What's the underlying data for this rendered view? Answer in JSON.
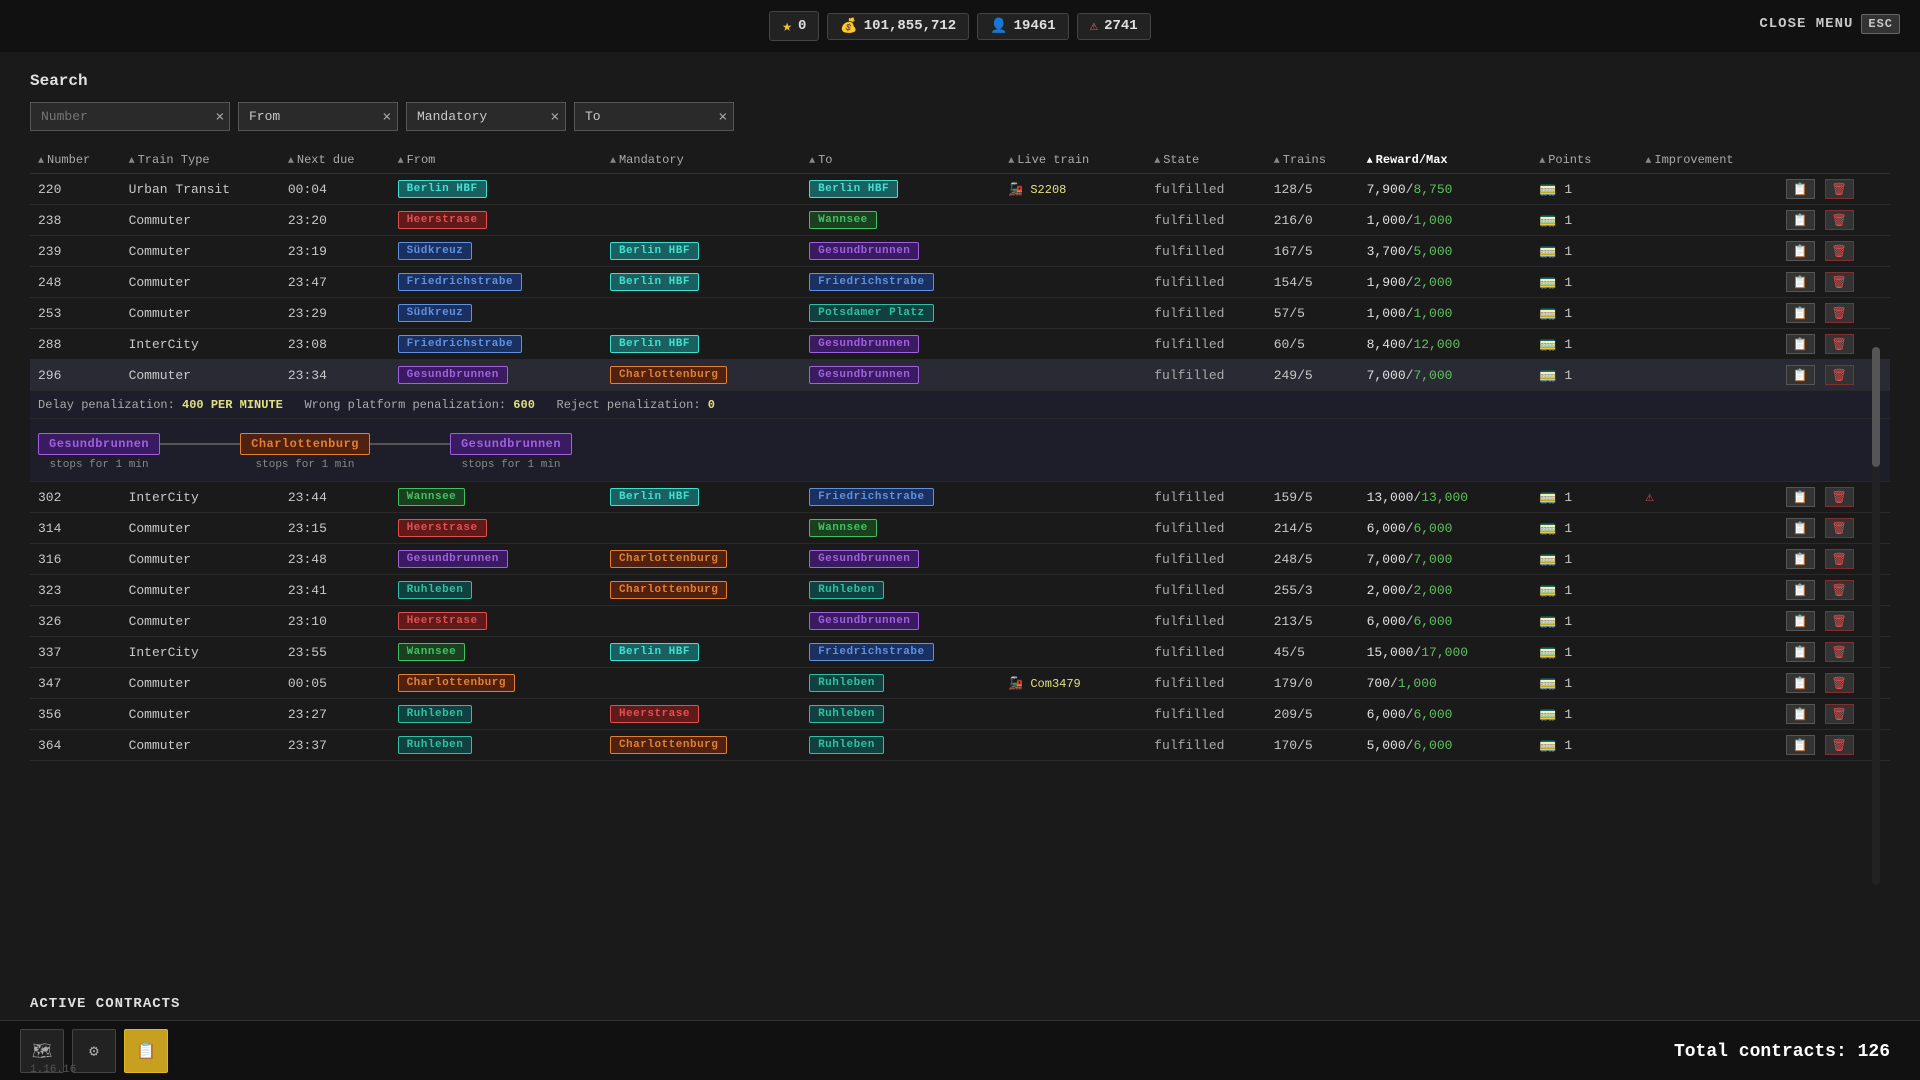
{
  "topbar": {
    "stars": "0",
    "cash": "101,855,712",
    "passengers": "19461",
    "warnings": "2741",
    "close_label": "CLOSE MENU",
    "esc_label": "ESC"
  },
  "search": {
    "label": "Search",
    "number_placeholder": "Number",
    "from_label": "From",
    "mandatory_label": "Mandatory",
    "to_label": "To"
  },
  "table": {
    "headers": [
      {
        "label": "Number",
        "sort": true,
        "active": false
      },
      {
        "label": "Train Type",
        "sort": true,
        "active": false
      },
      {
        "label": "Next due",
        "sort": true,
        "active": false
      },
      {
        "label": "From",
        "sort": true,
        "active": false
      },
      {
        "label": "Mandatory",
        "sort": true,
        "active": false
      },
      {
        "label": "To",
        "sort": true,
        "active": false
      },
      {
        "label": "Live train",
        "sort": true,
        "active": false
      },
      {
        "label": "State",
        "sort": true,
        "active": false
      },
      {
        "label": "Trains",
        "sort": true,
        "active": false
      },
      {
        "label": "Reward/Max",
        "sort": true,
        "active": true
      },
      {
        "label": "Points",
        "sort": true,
        "active": false
      },
      {
        "label": "Improvement",
        "sort": true,
        "active": false
      },
      {
        "label": "",
        "sort": false
      }
    ],
    "rows": [
      {
        "id": "220",
        "type": "Urban Transit",
        "next": "00:04",
        "from": "Berlin HBF",
        "from_color": "cyan",
        "mandatory": "",
        "to": "Berlin HBF",
        "to_color": "cyan",
        "live": "S2208",
        "live_icon": true,
        "state": "fulfilled",
        "trains": "128/5",
        "reward": "7,900",
        "max": "8,750",
        "points": "1",
        "improve": false,
        "selected": false
      },
      {
        "id": "238",
        "type": "Commuter",
        "next": "23:20",
        "from": "Heerstrase",
        "from_color": "red",
        "mandatory": "",
        "to": "Wannsee",
        "to_color": "green",
        "live": "",
        "live_icon": false,
        "state": "fulfilled",
        "trains": "216/0",
        "reward": "1,000",
        "max": "1,000",
        "points": "1",
        "improve": false,
        "selected": false
      },
      {
        "id": "239",
        "type": "Commuter",
        "next": "23:19",
        "from": "Südkreuz",
        "from_color": "blue",
        "mandatory": "Berlin HBF",
        "mandatory_color": "cyan",
        "to": "Gesundbrunnen",
        "to_color": "purple",
        "live": "",
        "live_icon": false,
        "state": "fulfilled",
        "trains": "167/5",
        "reward": "3,700",
        "max": "5,000",
        "points": "1",
        "improve": false,
        "selected": false
      },
      {
        "id": "248",
        "type": "Commuter",
        "next": "23:47",
        "from": "Friedrichstrabe",
        "from_color": "blue",
        "mandatory": "Berlin HBF",
        "mandatory_color": "cyan",
        "to": "Friedrichstrabe",
        "to_color": "blue",
        "live": "",
        "live_icon": false,
        "state": "fulfilled",
        "trains": "154/5",
        "reward": "1,900",
        "max": "2,000",
        "points": "1",
        "improve": false,
        "selected": false
      },
      {
        "id": "253",
        "type": "Commuter",
        "next": "23:29",
        "from": "Südkreuz",
        "from_color": "blue",
        "mandatory": "",
        "to": "Potsdamer Platz",
        "to_color": "teal",
        "live": "",
        "live_icon": false,
        "state": "fulfilled",
        "trains": "57/5",
        "reward": "1,000",
        "max": "1,000",
        "points": "1",
        "improve": false,
        "selected": false
      },
      {
        "id": "288",
        "type": "InterCity",
        "next": "23:08",
        "from": "Friedrichstrabe",
        "from_color": "blue",
        "mandatory": "Berlin HBF",
        "mandatory_color": "cyan",
        "to": "Gesundbrunnen",
        "to_color": "purple",
        "live": "",
        "live_icon": false,
        "state": "fulfilled",
        "trains": "60/5",
        "reward": "8,400",
        "max": "12,000",
        "points": "1",
        "improve": false,
        "selected": false
      },
      {
        "id": "296",
        "type": "Commuter",
        "next": "23:34",
        "from": "Gesundbrunnen",
        "from_color": "purple",
        "mandatory": "Charlottenburg",
        "mandatory_color": "orange",
        "to": "Gesundbrunnen",
        "to_color": "purple",
        "live": "",
        "live_icon": false,
        "state": "fulfilled",
        "trains": "249/5",
        "reward": "7,000",
        "max": "7,000",
        "points": "1",
        "improve": false,
        "selected": true
      },
      {
        "id": "302",
        "type": "InterCity",
        "next": "23:44",
        "from": "Wannsee",
        "from_color": "green",
        "mandatory": "Berlin HBF",
        "mandatory_color": "cyan",
        "to": "Friedrichstrabe",
        "to_color": "blue",
        "live": "",
        "live_icon": false,
        "state": "fulfilled",
        "trains": "159/5",
        "reward": "13,000",
        "max": "13,000",
        "points": "1",
        "improve": true,
        "warn": true,
        "selected": false
      },
      {
        "id": "314",
        "type": "Commuter",
        "next": "23:15",
        "from": "Heerstrase",
        "from_color": "red",
        "mandatory": "",
        "to": "Wannsee",
        "to_color": "green",
        "live": "",
        "live_icon": false,
        "state": "fulfilled",
        "trains": "214/5",
        "reward": "6,000",
        "max": "6,000",
        "points": "1",
        "improve": false,
        "selected": false
      },
      {
        "id": "316",
        "type": "Commuter",
        "next": "23:48",
        "from": "Gesundbrunnen",
        "from_color": "purple",
        "mandatory": "Charlottenburg",
        "mandatory_color": "orange",
        "to": "Gesundbrunnen",
        "to_color": "purple",
        "live": "",
        "live_icon": false,
        "state": "fulfilled",
        "trains": "248/5",
        "reward": "7,000",
        "max": "7,000",
        "points": "1",
        "improve": false,
        "selected": false
      },
      {
        "id": "323",
        "type": "Commuter",
        "next": "23:41",
        "from": "Ruhleben",
        "from_color": "teal",
        "mandatory": "Charlottenburg",
        "mandatory_color": "orange",
        "to": "Ruhleben",
        "to_color": "teal",
        "live": "",
        "live_icon": false,
        "state": "fulfilled",
        "trains": "255/3",
        "reward": "2,000",
        "max": "2,000",
        "points": "1",
        "improve": false,
        "selected": false
      },
      {
        "id": "326",
        "type": "Commuter",
        "next": "23:10",
        "from": "Heerstrase",
        "from_color": "red",
        "mandatory": "",
        "to": "Gesundbrunnen",
        "to_color": "purple",
        "live": "",
        "live_icon": false,
        "state": "fulfilled",
        "trains": "213/5",
        "reward": "6,000",
        "max": "6,000",
        "points": "1",
        "improve": false,
        "selected": false
      },
      {
        "id": "337",
        "type": "InterCity",
        "next": "23:55",
        "from": "Wannsee",
        "from_color": "green",
        "mandatory": "Berlin HBF",
        "mandatory_color": "cyan",
        "to": "Friedrichstrabe",
        "to_color": "blue",
        "live": "",
        "live_icon": false,
        "state": "fulfilled",
        "trains": "45/5",
        "reward": "15,000",
        "max": "17,000",
        "points": "1",
        "improve": false,
        "selected": false
      },
      {
        "id": "347",
        "type": "Commuter",
        "next": "00:05",
        "from": "Charlottenburg",
        "from_color": "orange",
        "mandatory": "",
        "to": "Ruhleben",
        "to_color": "teal",
        "live": "Com3479",
        "live_icon": true,
        "state": "fulfilled",
        "trains": "179/0",
        "reward": "700",
        "max": "1,000",
        "points": "1",
        "improve": false,
        "selected": false
      },
      {
        "id": "356",
        "type": "Commuter",
        "next": "23:27",
        "from": "Ruhleben",
        "from_color": "teal",
        "mandatory": "Heerstrase",
        "mandatory_color": "red",
        "to": "Ruhleben",
        "to_color": "teal",
        "live": "",
        "live_icon": false,
        "state": "fulfilled",
        "trains": "209/5",
        "reward": "6,000",
        "max": "6,000",
        "points": "1",
        "improve": false,
        "selected": false
      },
      {
        "id": "364",
        "type": "Commuter",
        "next": "23:37",
        "from": "Ruhleben",
        "from_color": "teal",
        "mandatory": "Charlottenburg",
        "mandatory_color": "orange",
        "to": "Ruhleben",
        "to_color": "teal",
        "live": "",
        "live_icon": false,
        "state": "fulfilled",
        "trains": "170/5",
        "reward": "5,000",
        "max": "6,000",
        "points": "1",
        "improve": false,
        "selected": false
      }
    ],
    "selected_row": {
      "penalty_delay": "400 PER MINUTE",
      "penalty_platform": "600",
      "penalty_reject": "0",
      "route_stops": [
        {
          "name": "Gesundbrunnen",
          "color": "purple",
          "info": "stops for 1 min"
        },
        {
          "name": "Charlottenburg",
          "color": "orange",
          "info": "stops for 1 min"
        },
        {
          "name": "Gesundbrunnen",
          "color": "purple",
          "info": "stops for 1 min"
        }
      ]
    }
  },
  "bottom": {
    "active_contracts_label": "ACTIVE CONTRACTS",
    "total_label": "Total contracts:",
    "total_count": "126",
    "version": "1.16.16",
    "tools": [
      {
        "icon": "🗺",
        "active": false,
        "label": "map-tool"
      },
      {
        "icon": "⚙",
        "active": false,
        "label": "settings-tool"
      },
      {
        "icon": "📋",
        "active": true,
        "label": "contracts-tool"
      }
    ]
  }
}
